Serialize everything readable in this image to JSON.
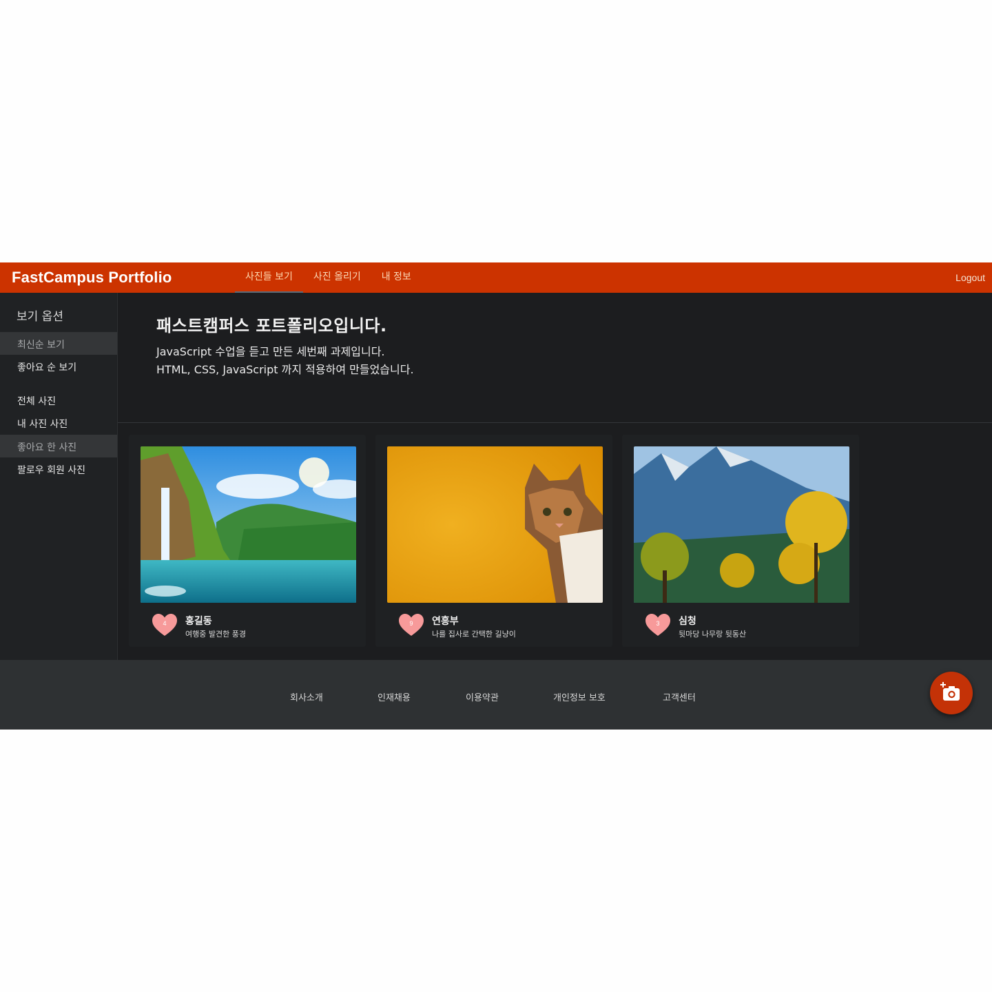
{
  "header": {
    "brand": "FastCampus Portfolio",
    "nav": [
      "사진들 보기",
      "사진 올리기",
      "내 정보"
    ],
    "active_nav": "사진들 보기",
    "logout": "Logout"
  },
  "sidebar": {
    "title": "보기 옵션",
    "sort_options": [
      "최신순 보기",
      "좋아요 순 보기"
    ],
    "filter_options": [
      "전체 사진",
      "내 사진 사진",
      "좋아요 한 사진",
      "팔로우 회원 사진"
    ],
    "selected": [
      "최신순 보기",
      "좋아요 한 사진"
    ]
  },
  "intro": {
    "title": "패스트캠퍼스 포트폴리오입니다.",
    "lines": [
      "JavaScript 수업을 듣고 만든 세번째 과제입니다.",
      "HTML, CSS, JavaScript 까지 적용하여 만들었습니다."
    ]
  },
  "cards": [
    {
      "image": "waterfall-landscape",
      "likes": "4",
      "user": "홍길동",
      "description": "여행중 발견한 풍경"
    },
    {
      "image": "cat-on-orange",
      "likes": "9",
      "user": "연흥부",
      "description": "나를 집사로 간택한 길냥이"
    },
    {
      "image": "mountain-yellow-trees",
      "likes": "3",
      "user": "심청",
      "description": "뒷마당 나무랑 뒷동산"
    }
  ],
  "footer": {
    "links": [
      "회사소개",
      "인재채용",
      "이용약관",
      "개인정보 보호",
      "고객센터"
    ]
  },
  "fab": {
    "icon": "add-photo-icon"
  },
  "colors": {
    "brand": "#cc3300",
    "background": "#1c1d1f",
    "footer": "#2e3133",
    "heart": "#f79a9a"
  }
}
